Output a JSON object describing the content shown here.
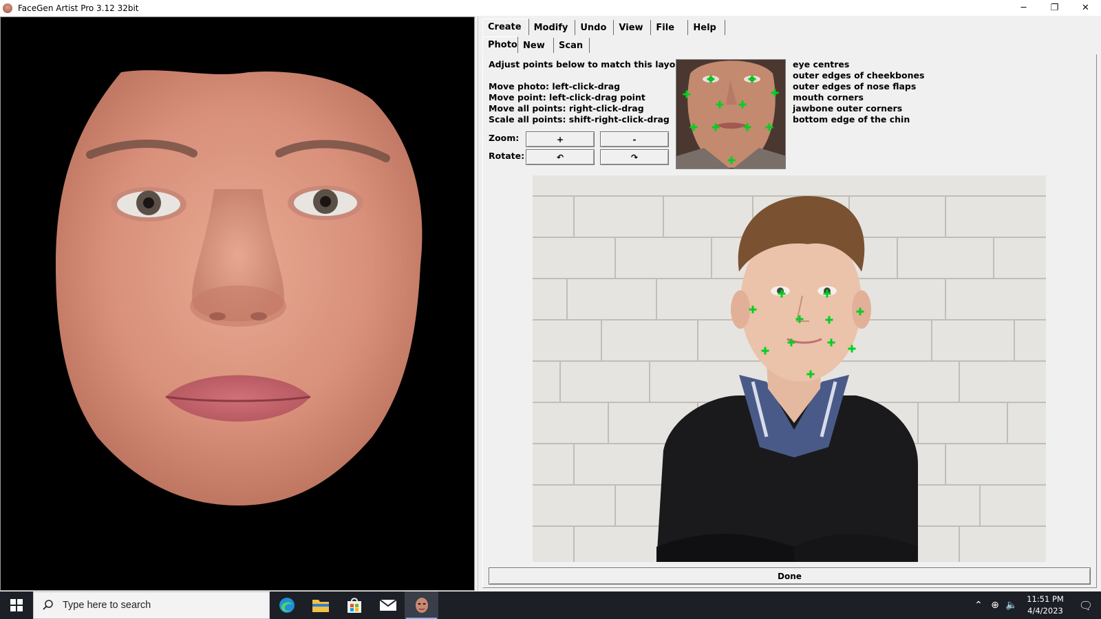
{
  "window": {
    "title": "FaceGen Artist Pro 3.12 32bit",
    "minimize": "─",
    "maximize": "❐",
    "close": "✕"
  },
  "tabs": {
    "main": [
      {
        "label": "Create",
        "active": true
      },
      {
        "label": "Modify",
        "active": false
      },
      {
        "label": "Undo",
        "active": false
      },
      {
        "label": "View",
        "active": false
      },
      {
        "label": "File",
        "active": false
      },
      {
        "label": "Help",
        "active": false
      }
    ],
    "sub": [
      {
        "label": "Photo",
        "active": true
      },
      {
        "label": "New",
        "active": false
      },
      {
        "label": "Scan",
        "active": false
      }
    ]
  },
  "instructions": {
    "header": "Adjust points below to match this layout:",
    "move_photo": "Move photo: left-click-drag",
    "move_point": "Move point: left-click-drag point",
    "move_all": "Move all points: right-click-drag",
    "scale_all": "Scale all points: shift-right-click-drag"
  },
  "controls": {
    "zoom_label": "Zoom:",
    "zoom_in": "+",
    "zoom_out": "-",
    "rotate_label": "Rotate:",
    "rotate_ccw": "↶",
    "rotate_cw": "↷"
  },
  "key_points": [
    "eye centres",
    "outer edges of cheekbones",
    "outer edges of nose flaps",
    "mouth corners",
    "jawbone outer corners",
    "bottom edge of the chin"
  ],
  "done_label": "Done",
  "taskbar": {
    "search_placeholder": "Type here to search",
    "time": "11:51 PM",
    "date": "4/4/2023",
    "apps": [
      "edge-icon",
      "file-explorer-icon",
      "store-icon",
      "mail-icon",
      "facegen-icon"
    ]
  }
}
